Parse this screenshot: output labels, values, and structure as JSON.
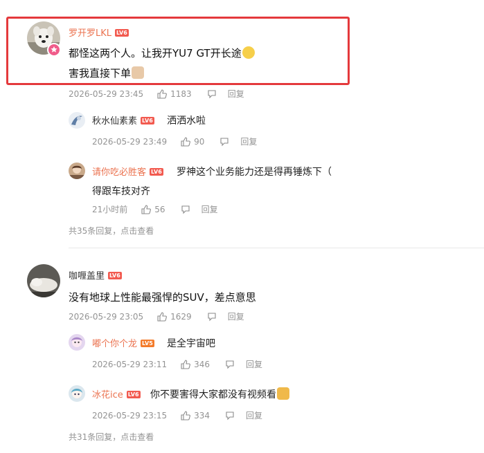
{
  "comments": [
    {
      "user": "罗开罗LKL",
      "level": "LV6",
      "line1": "都怪这两个人。让我开YU7 GT开长途",
      "line2": "害我直接下单",
      "time": "2026-05-29 23:45",
      "likes": "1183",
      "reply_label": "回复",
      "replies": [
        {
          "user": "秋水仙素素",
          "level": "LV6",
          "text": "洒洒水啦",
          "time": "2026-05-29 23:49",
          "likes": "90",
          "reply_label": "回复"
        },
        {
          "user": "请你吃必胜客",
          "level": "LV6",
          "text_line1": "罗神这个业务能力还是得再锤炼下（",
          "text_line2": "得跟车技对齐",
          "time": "21小时前",
          "likes": "56",
          "reply_label": "回复"
        }
      ],
      "more_replies": "共35条回复，点击查看"
    },
    {
      "user": "咖喱盖里",
      "level": "LV6",
      "text": "没有地球上性能最强悍的SUV，差点意思",
      "time": "2026-05-29 23:05",
      "likes": "1629",
      "reply_label": "回复",
      "replies": [
        {
          "user": "嘟个你个龙",
          "level": "LV5",
          "text": "是全宇宙吧",
          "time": "2026-05-29 23:11",
          "likes": "346",
          "reply_label": "回复"
        },
        {
          "user": "冰花ice",
          "level": "LV6",
          "text": "你不要害得大家都没有视频看",
          "time": "2026-05-29 23:15",
          "likes": "334",
          "reply_label": "回复"
        }
      ],
      "more_replies": "共31条回复，点击查看"
    }
  ],
  "colors": {
    "highlight": "#e4393c",
    "username_accent": "#eb7350",
    "meta_gray": "#939393"
  }
}
